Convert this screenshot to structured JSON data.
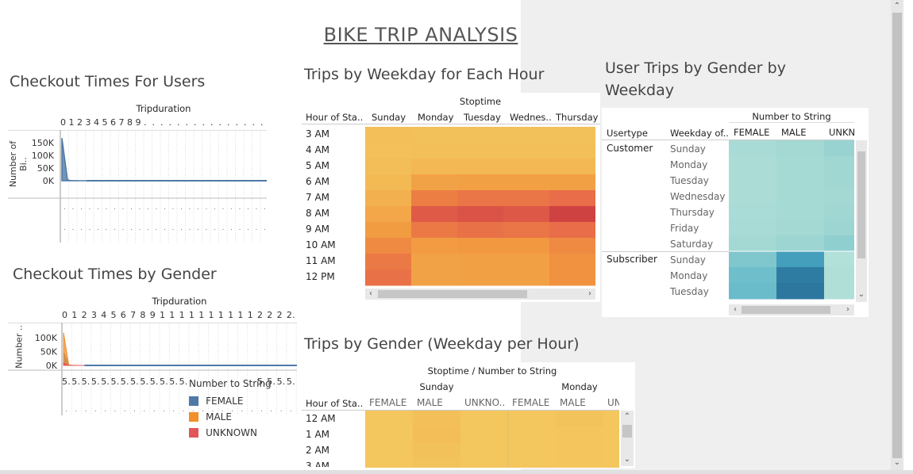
{
  "title": "BIKE TRIP ANALYSIS",
  "checkout_users": {
    "title": "Checkout Times For Users",
    "x_header": "Tripduration",
    "y_label": "Number of Bi..",
    "x_ticks": [
      "0",
      "1",
      "2",
      "3",
      "4",
      "5",
      "6",
      "7",
      "8",
      "9"
    ]
  },
  "checkout_gender": {
    "title": "Checkout Times by Gender",
    "x_header": "Tripduration",
    "y_label": "Number ..",
    "x_ticks": [
      "0",
      "1",
      "2",
      "3",
      "4",
      "5",
      "6",
      "7",
      "8",
      "9",
      "1",
      "1",
      "1",
      "1",
      "1",
      "1",
      "1",
      "1",
      "1",
      "1",
      "2",
      "2",
      "2",
      "2."
    ],
    "bottom_tick": "5.",
    "legend": {
      "title": "Number to String",
      "items": [
        {
          "label": "FEMALE",
          "color": "#4e79a7"
        },
        {
          "label": "MALE",
          "color": "#f28e2b"
        },
        {
          "label": "UNKNOWN",
          "color": "#e15759"
        }
      ]
    }
  },
  "weekday_hour": {
    "title": "Trips by Weekday for Each Hour",
    "col_header": "Stoptime",
    "row_header": "Hour of Sta..",
    "columns": [
      "Sunday",
      "Monday",
      "Tuesday",
      "Wednes..",
      "Thursday"
    ],
    "rows": [
      "3 AM",
      "4 AM",
      "5 AM",
      "6 AM",
      "7 AM",
      "8 AM",
      "9 AM",
      "10 AM",
      "11 AM",
      "12 PM"
    ]
  },
  "gender_weekday": {
    "title": "User Trips by Gender by Weekday",
    "col_header": "Number to String",
    "usertype_header": "Usertype",
    "weekday_header": "Weekday of..",
    "columns": [
      "FEMALE",
      "MALE",
      "UNKN"
    ],
    "groups": [
      {
        "name": "Customer",
        "days": [
          "Sunday",
          "Monday",
          "Tuesday",
          "Wednesday",
          "Thursday",
          "Friday",
          "Saturday"
        ]
      },
      {
        "name": "Subscriber",
        "days": [
          "Sunday",
          "Monday",
          "Tuesday"
        ]
      }
    ]
  },
  "gender_weekday_hour": {
    "title": "Trips by Gender (Weekday per Hour)",
    "col_header": "Stoptime  /  Number to String",
    "row_header": "Hour of Sta..",
    "days": [
      "Sunday",
      "Monday"
    ],
    "columns": [
      "FEMALE",
      "MALE",
      "UNKNO..",
      "FEMALE",
      "MALE",
      "UN"
    ],
    "rows": [
      "12 AM",
      "1 AM",
      "2 AM",
      "3 AM"
    ]
  },
  "chart_data": [
    {
      "type": "area",
      "title": "Checkout Times For Users",
      "xlabel": "Tripduration",
      "ylabel": "Number of Bi..",
      "x": [
        0,
        1,
        2,
        3,
        4,
        5,
        6,
        7,
        8,
        9
      ],
      "values": [
        168000,
        4000,
        1000,
        500,
        300,
        200,
        100,
        100,
        100,
        100
      ],
      "ylim": [
        0,
        175000
      ],
      "yticks": [
        "0K",
        "50K",
        "100K",
        "150K"
      ]
    },
    {
      "type": "area",
      "title": "Checkout Times by Gender",
      "xlabel": "Tripduration",
      "ylabel": "Number ..",
      "x": [
        0,
        1,
        2,
        3,
        4,
        5,
        6,
        7,
        8,
        9
      ],
      "series": [
        {
          "name": "FEMALE",
          "values": [
            48000,
            1500,
            400,
            200,
            100,
            100,
            50,
            50,
            50,
            50
          ]
        },
        {
          "name": "MALE",
          "values": [
            118000,
            3000,
            800,
            300,
            200,
            100,
            100,
            50,
            50,
            50
          ]
        },
        {
          "name": "UNKNOWN",
          "values": [
            9000,
            500,
            100,
            50,
            50,
            0,
            0,
            0,
            0,
            0
          ]
        }
      ],
      "ylim": [
        0,
        120000
      ],
      "yticks": [
        "0K",
        "50K",
        "100K"
      ]
    },
    {
      "type": "heatmap",
      "title": "Trips by Weekday for Each Hour",
      "x": [
        "Sunday",
        "Monday",
        "Tuesday",
        "Wednes..",
        "Thursday"
      ],
      "y": [
        "3 AM",
        "4 AM",
        "5 AM",
        "6 AM",
        "7 AM",
        "8 AM",
        "9 AM",
        "10 AM",
        "11 AM",
        "12 PM"
      ],
      "values": [
        [
          0.16,
          0.14,
          0.14,
          0.14,
          0.14
        ],
        [
          0.15,
          0.16,
          0.16,
          0.16,
          0.16
        ],
        [
          0.17,
          0.22,
          0.22,
          0.22,
          0.22
        ],
        [
          0.2,
          0.4,
          0.42,
          0.42,
          0.42
        ],
        [
          0.28,
          0.62,
          0.66,
          0.66,
          0.7
        ],
        [
          0.36,
          0.8,
          0.85,
          0.82,
          0.95
        ],
        [
          0.45,
          0.64,
          0.68,
          0.66,
          0.7
        ],
        [
          0.56,
          0.46,
          0.48,
          0.48,
          0.56
        ],
        [
          0.64,
          0.4,
          0.42,
          0.42,
          0.52
        ],
        [
          0.68,
          0.4,
          0.42,
          0.42,
          0.52
        ]
      ]
    },
    {
      "type": "heatmap",
      "title": "User Trips by Gender by Weekday",
      "x": [
        "FEMALE",
        "MALE",
        "UNKN"
      ],
      "y": [
        "Customer Sunday",
        "Customer Monday",
        "Customer Tuesday",
        "Customer Wednesday",
        "Customer Thursday",
        "Customer Friday",
        "Customer Saturday",
        "Subscriber Sunday",
        "Subscriber Monday",
        "Subscriber Tuesday"
      ],
      "values": [
        [
          0.18,
          0.22,
          0.28
        ],
        [
          0.16,
          0.2,
          0.24
        ],
        [
          0.16,
          0.2,
          0.24
        ],
        [
          0.16,
          0.2,
          0.22
        ],
        [
          0.17,
          0.21,
          0.24
        ],
        [
          0.18,
          0.22,
          0.26
        ],
        [
          0.22,
          0.26,
          0.32
        ],
        [
          0.4,
          0.7,
          0.1
        ],
        [
          0.48,
          0.92,
          0.12
        ],
        [
          0.5,
          0.95,
          0.12
        ]
      ]
    },
    {
      "type": "heatmap",
      "title": "Trips by Gender (Weekday per Hour)",
      "x": [
        "Sunday FEMALE",
        "Sunday MALE",
        "Sunday UNKNO..",
        "Monday FEMALE",
        "Monday MALE",
        "Monday UN"
      ],
      "y": [
        "12 AM",
        "1 AM",
        "2 AM",
        "3 AM"
      ],
      "values": [
        [
          0.12,
          0.2,
          0.12,
          0.12,
          0.16,
          0.12
        ],
        [
          0.12,
          0.22,
          0.12,
          0.12,
          0.14,
          0.12
        ],
        [
          0.12,
          0.18,
          0.12,
          0.12,
          0.14,
          0.12
        ],
        [
          0.12,
          0.16,
          0.12,
          0.12,
          0.14,
          0.12
        ]
      ]
    }
  ]
}
